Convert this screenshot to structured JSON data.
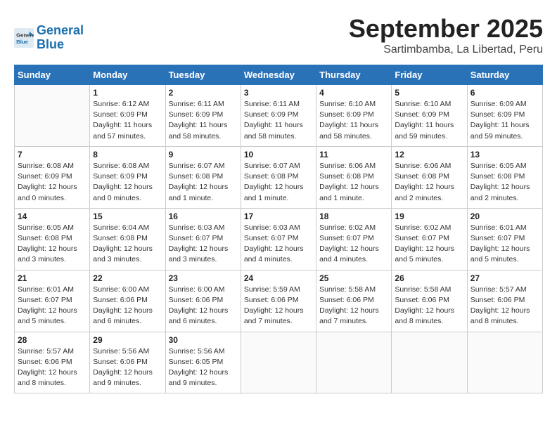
{
  "header": {
    "logo_line1": "General",
    "logo_line2": "Blue",
    "title": "September 2025",
    "subtitle": "Sartimbamba, La Libertad, Peru"
  },
  "weekdays": [
    "Sunday",
    "Monday",
    "Tuesday",
    "Wednesday",
    "Thursday",
    "Friday",
    "Saturday"
  ],
  "weeks": [
    [
      {
        "day": "",
        "info": ""
      },
      {
        "day": "1",
        "info": "Sunrise: 6:12 AM\nSunset: 6:09 PM\nDaylight: 11 hours\nand 57 minutes."
      },
      {
        "day": "2",
        "info": "Sunrise: 6:11 AM\nSunset: 6:09 PM\nDaylight: 11 hours\nand 58 minutes."
      },
      {
        "day": "3",
        "info": "Sunrise: 6:11 AM\nSunset: 6:09 PM\nDaylight: 11 hours\nand 58 minutes."
      },
      {
        "day": "4",
        "info": "Sunrise: 6:10 AM\nSunset: 6:09 PM\nDaylight: 11 hours\nand 58 minutes."
      },
      {
        "day": "5",
        "info": "Sunrise: 6:10 AM\nSunset: 6:09 PM\nDaylight: 11 hours\nand 59 minutes."
      },
      {
        "day": "6",
        "info": "Sunrise: 6:09 AM\nSunset: 6:09 PM\nDaylight: 11 hours\nand 59 minutes."
      }
    ],
    [
      {
        "day": "7",
        "info": "Sunrise: 6:08 AM\nSunset: 6:09 PM\nDaylight: 12 hours\nand 0 minutes."
      },
      {
        "day": "8",
        "info": "Sunrise: 6:08 AM\nSunset: 6:09 PM\nDaylight: 12 hours\nand 0 minutes."
      },
      {
        "day": "9",
        "info": "Sunrise: 6:07 AM\nSunset: 6:08 PM\nDaylight: 12 hours\nand 1 minute."
      },
      {
        "day": "10",
        "info": "Sunrise: 6:07 AM\nSunset: 6:08 PM\nDaylight: 12 hours\nand 1 minute."
      },
      {
        "day": "11",
        "info": "Sunrise: 6:06 AM\nSunset: 6:08 PM\nDaylight: 12 hours\nand 1 minute."
      },
      {
        "day": "12",
        "info": "Sunrise: 6:06 AM\nSunset: 6:08 PM\nDaylight: 12 hours\nand 2 minutes."
      },
      {
        "day": "13",
        "info": "Sunrise: 6:05 AM\nSunset: 6:08 PM\nDaylight: 12 hours\nand 2 minutes."
      }
    ],
    [
      {
        "day": "14",
        "info": "Sunrise: 6:05 AM\nSunset: 6:08 PM\nDaylight: 12 hours\nand 3 minutes."
      },
      {
        "day": "15",
        "info": "Sunrise: 6:04 AM\nSunset: 6:08 PM\nDaylight: 12 hours\nand 3 minutes."
      },
      {
        "day": "16",
        "info": "Sunrise: 6:03 AM\nSunset: 6:07 PM\nDaylight: 12 hours\nand 3 minutes."
      },
      {
        "day": "17",
        "info": "Sunrise: 6:03 AM\nSunset: 6:07 PM\nDaylight: 12 hours\nand 4 minutes."
      },
      {
        "day": "18",
        "info": "Sunrise: 6:02 AM\nSunset: 6:07 PM\nDaylight: 12 hours\nand 4 minutes."
      },
      {
        "day": "19",
        "info": "Sunrise: 6:02 AM\nSunset: 6:07 PM\nDaylight: 12 hours\nand 5 minutes."
      },
      {
        "day": "20",
        "info": "Sunrise: 6:01 AM\nSunset: 6:07 PM\nDaylight: 12 hours\nand 5 minutes."
      }
    ],
    [
      {
        "day": "21",
        "info": "Sunrise: 6:01 AM\nSunset: 6:07 PM\nDaylight: 12 hours\nand 5 minutes."
      },
      {
        "day": "22",
        "info": "Sunrise: 6:00 AM\nSunset: 6:06 PM\nDaylight: 12 hours\nand 6 minutes."
      },
      {
        "day": "23",
        "info": "Sunrise: 6:00 AM\nSunset: 6:06 PM\nDaylight: 12 hours\nand 6 minutes."
      },
      {
        "day": "24",
        "info": "Sunrise: 5:59 AM\nSunset: 6:06 PM\nDaylight: 12 hours\nand 7 minutes."
      },
      {
        "day": "25",
        "info": "Sunrise: 5:58 AM\nSunset: 6:06 PM\nDaylight: 12 hours\nand 7 minutes."
      },
      {
        "day": "26",
        "info": "Sunrise: 5:58 AM\nSunset: 6:06 PM\nDaylight: 12 hours\nand 8 minutes."
      },
      {
        "day": "27",
        "info": "Sunrise: 5:57 AM\nSunset: 6:06 PM\nDaylight: 12 hours\nand 8 minutes."
      }
    ],
    [
      {
        "day": "28",
        "info": "Sunrise: 5:57 AM\nSunset: 6:06 PM\nDaylight: 12 hours\nand 8 minutes."
      },
      {
        "day": "29",
        "info": "Sunrise: 5:56 AM\nSunset: 6:06 PM\nDaylight: 12 hours\nand 9 minutes."
      },
      {
        "day": "30",
        "info": "Sunrise: 5:56 AM\nSunset: 6:05 PM\nDaylight: 12 hours\nand 9 minutes."
      },
      {
        "day": "",
        "info": ""
      },
      {
        "day": "",
        "info": ""
      },
      {
        "day": "",
        "info": ""
      },
      {
        "day": "",
        "info": ""
      }
    ]
  ]
}
